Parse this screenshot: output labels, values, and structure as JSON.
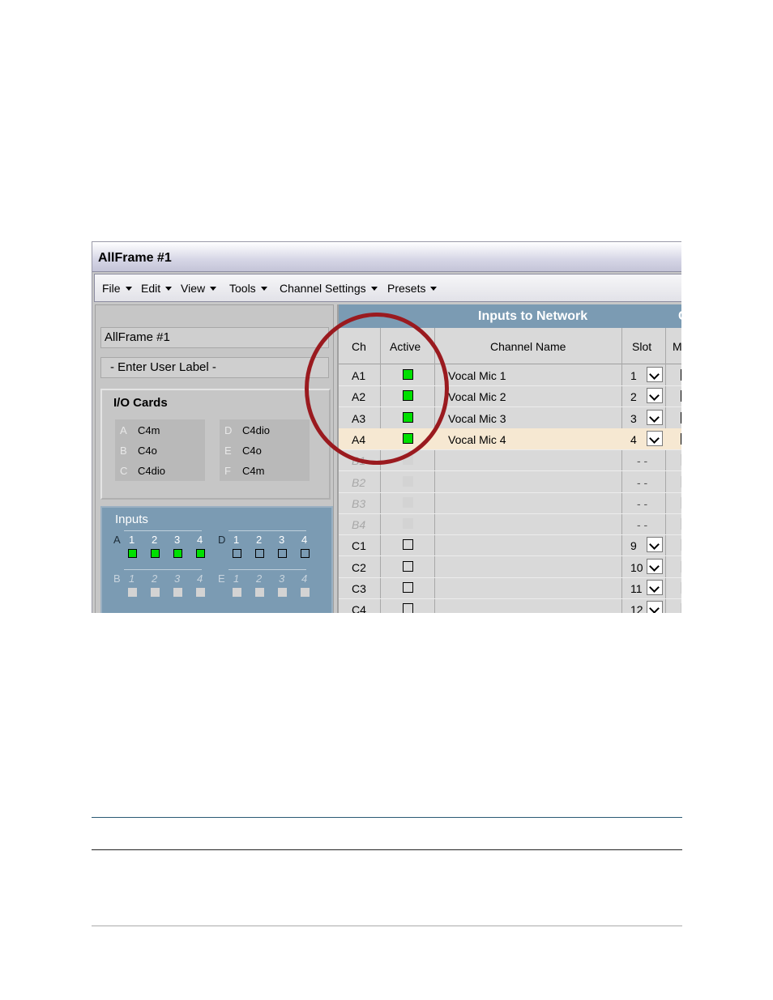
{
  "window": {
    "title": "AllFrame #1"
  },
  "menu": [
    "File",
    "Edit",
    "View",
    "Tools",
    "Channel Settings",
    "Presets"
  ],
  "device": {
    "name": "AllFrame #1",
    "user_label": "- Enter User Label -"
  },
  "io_cards": {
    "title": "I/O Cards",
    "left": [
      {
        "slot": "A",
        "card": "C4m"
      },
      {
        "slot": "B",
        "card": "C4o"
      },
      {
        "slot": "C",
        "card": "C4dio"
      }
    ],
    "right": [
      {
        "slot": "D",
        "card": "C4dio"
      },
      {
        "slot": "E",
        "card": "C4o"
      },
      {
        "slot": "F",
        "card": "C4m"
      }
    ]
  },
  "inputs": {
    "title": "Inputs",
    "groups": [
      {
        "letter": "A",
        "nums": [
          "1",
          "2",
          "3",
          "4"
        ],
        "state": [
          "on",
          "on",
          "on",
          "on"
        ]
      },
      {
        "letter": "D",
        "nums": [
          "1",
          "2",
          "3",
          "4"
        ],
        "state": [
          "off",
          "off",
          "off",
          "off"
        ]
      },
      {
        "letter": "B",
        "nums": [
          "1",
          "2",
          "3",
          "4"
        ],
        "state": [
          "dis",
          "dis",
          "dis",
          "dis"
        ]
      },
      {
        "letter": "E",
        "nums": [
          "1",
          "2",
          "3",
          "4"
        ],
        "state": [
          "dis",
          "dis",
          "dis",
          "dis"
        ]
      }
    ]
  },
  "table": {
    "title": "Inputs to Network",
    "next_title_fragment": "C",
    "columns": {
      "ch": "Ch",
      "active": "Active",
      "name": "Channel Name",
      "slot": "Slot",
      "m": "M"
    },
    "rows": [
      {
        "ch": "A1",
        "active": "on",
        "name": "Vocal Mic 1",
        "slot": "1"
      },
      {
        "ch": "A2",
        "active": "on",
        "name": "Vocal Mic 2",
        "slot": "2"
      },
      {
        "ch": "A3",
        "active": "on",
        "name": "Vocal Mic 3",
        "slot": "3"
      },
      {
        "ch": "A4",
        "active": "on",
        "name": "Vocal Mic 4",
        "slot": "4",
        "selected": true
      },
      {
        "ch": "B1",
        "active": "dis",
        "name": "",
        "slot": "- -"
      },
      {
        "ch": "B2",
        "active": "dis",
        "name": "",
        "slot": "- -"
      },
      {
        "ch": "B3",
        "active": "dis",
        "name": "",
        "slot": "- -"
      },
      {
        "ch": "B4",
        "active": "dis",
        "name": "",
        "slot": "- -"
      },
      {
        "ch": "C1",
        "active": "off",
        "name": "",
        "slot": "9"
      },
      {
        "ch": "C2",
        "active": "off",
        "name": "",
        "slot": "10"
      },
      {
        "ch": "C3",
        "active": "off",
        "name": "",
        "slot": "11"
      },
      {
        "ch": "C4",
        "active": "off",
        "name": "",
        "slot": "12"
      }
    ]
  },
  "colors": {
    "accent": "#7b9bb3",
    "active_green": "#00e000",
    "annotation_circle": "#9a1a1f",
    "rule": "#1f4f6a"
  }
}
